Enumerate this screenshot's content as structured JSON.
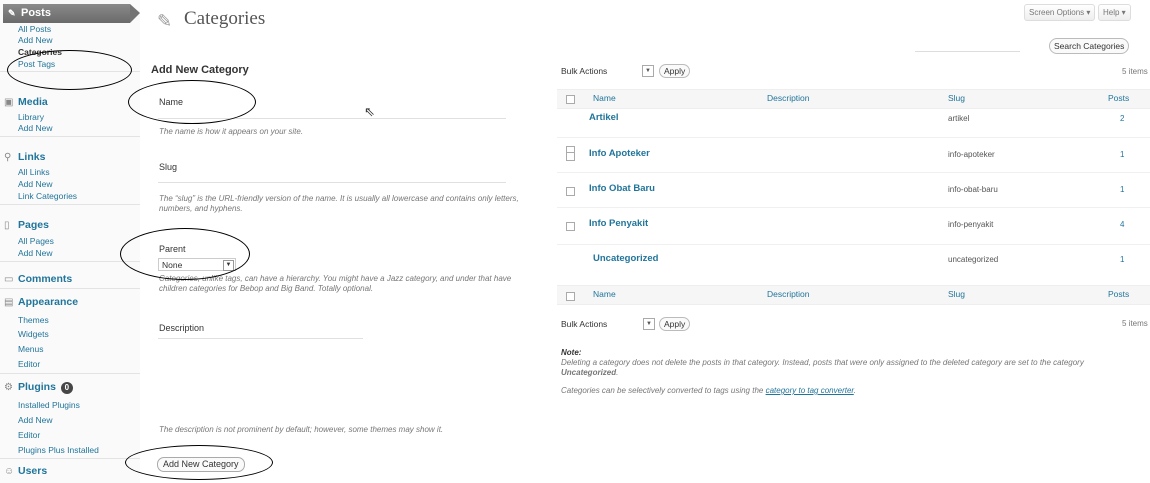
{
  "sidebar": {
    "posts": {
      "label": "Posts",
      "items": [
        "All Posts",
        "Add New",
        "Categories",
        "Post Tags"
      ]
    },
    "media": {
      "label": "Media",
      "items": [
        "Library",
        "Add New"
      ]
    },
    "links": {
      "label": "Links",
      "items": [
        "All Links",
        "Add New",
        "Link Categories"
      ]
    },
    "pages": {
      "label": "Pages",
      "items": [
        "All Pages",
        "Add New"
      ]
    },
    "comments": {
      "label": "Comments"
    },
    "appearance": {
      "label": "Appearance",
      "items": [
        "Themes",
        "Widgets",
        "Menus",
        "Editor"
      ]
    },
    "plugins": {
      "label": "Plugins",
      "badge": "0",
      "items": [
        "Installed Plugins",
        "Add New",
        "Editor",
        "Plugins Plus Installed"
      ]
    },
    "users": {
      "label": "Users"
    }
  },
  "header": {
    "title": "Categories",
    "screen_options": "Screen Options ▾",
    "help": "Help ▾",
    "search_button": "Search Categories"
  },
  "form": {
    "heading": "Add New Category",
    "name_label": "Name",
    "name_hint": "The name is how it appears on your site.",
    "slug_label": "Slug",
    "slug_hint": "The “slug” is the URL-friendly version of the name. It is usually all lowercase and contains only letters, numbers, and hyphens.",
    "parent_label": "Parent",
    "parent_value": "None",
    "parent_hint": "Categories, unlike tags, can have a hierarchy. You might have a Jazz category, and under that have children categories for Bebop and Big Band. Totally optional.",
    "description_label": "Description",
    "description_hint": "The description is not prominent by default; however, some themes may show it.",
    "submit": "Add New Category"
  },
  "table": {
    "bulk_actions": "Bulk Actions",
    "apply": "Apply",
    "item_count": "5 items",
    "headers": {
      "name": "Name",
      "description": "Description",
      "slug": "Slug",
      "posts": "Posts"
    },
    "rows": [
      {
        "name": "Artikel",
        "slug": "artikel",
        "posts": "2"
      },
      {
        "name": "Info Apoteker",
        "slug": "info-apoteker",
        "posts": "1"
      },
      {
        "name": "Info Obat Baru",
        "slug": "info-obat-baru",
        "posts": "1"
      },
      {
        "name": "Info Penyakit",
        "slug": "info-penyakit",
        "posts": "4"
      },
      {
        "name": "Uncategorized",
        "slug": "uncategorized",
        "posts": "1"
      }
    ]
  },
  "notes": {
    "label": "Note:",
    "line1": "Deleting a category does not delete the posts in that category. Instead, posts that were only assigned to the deleted category are set to the category",
    "line1_strong": "Uncategorized",
    "line2_prefix": "Categories can be selectively converted to tags using the",
    "line2_link": "category to tag converter"
  },
  "colors": {
    "link": "#21759b",
    "menu_active": "#6a6a6a",
    "annotation": "#000000"
  }
}
